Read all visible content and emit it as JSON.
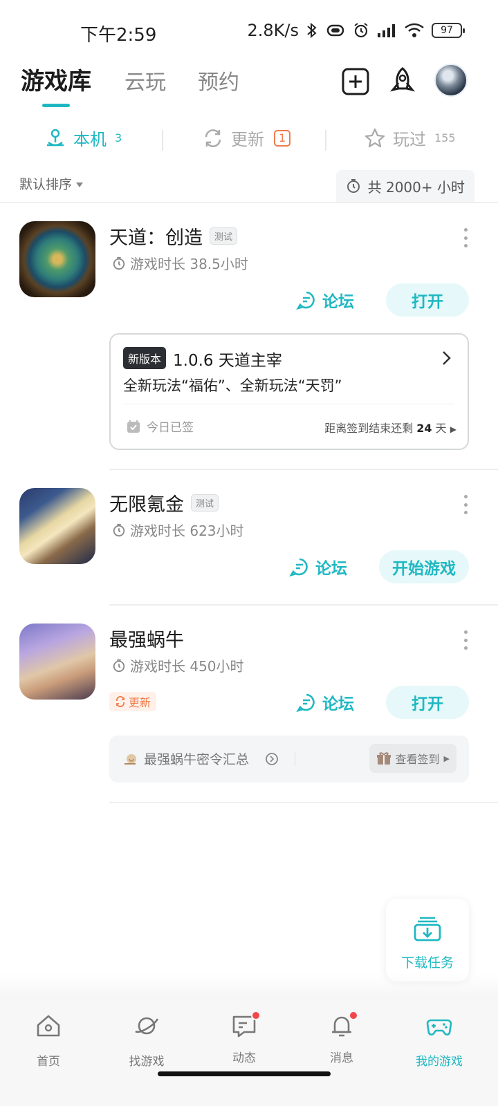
{
  "status_bar": {
    "time": "下午2:59",
    "speed": "2.8K/s",
    "battery": "97"
  },
  "top_nav": {
    "tabs": [
      {
        "label": "游戏库",
        "active": true
      },
      {
        "label": "云玩",
        "active": false
      },
      {
        "label": "预约",
        "active": false
      }
    ],
    "icons": [
      "add-icon",
      "rocket-icon",
      "avatar"
    ]
  },
  "sub_tabs": [
    {
      "label": "本机",
      "count": "3",
      "icon": "local-icon"
    },
    {
      "label": "更新",
      "badge": "1",
      "icon": "refresh-icon"
    },
    {
      "label": "玩过",
      "count": "155",
      "icon": "star-icon"
    }
  ],
  "sort": {
    "label": "默认排序",
    "total_time": "共 2000+ 小时"
  },
  "games": [
    {
      "title": "天道：创造",
      "tag": "测试",
      "play_time": "游戏时长 38.5小时",
      "forum": "论坛",
      "action": "打开",
      "version_card": {
        "badge": "新版本",
        "title": "1.0.6 天道主宰",
        "desc": "全新玩法“福佑”、全新玩法“天罚”",
        "signed": "今日已签",
        "sign_left_prefix": "距离签到结束还剩",
        "sign_left_days": "24",
        "sign_left_suffix": "天"
      }
    },
    {
      "title": "无限氪金",
      "tag": "测试",
      "play_time": "游戏时长 623小时",
      "forum": "论坛",
      "action": "开始游戏"
    },
    {
      "title": "最强蜗牛",
      "play_time": "游戏时长 450小时",
      "forum": "论坛",
      "action": "打开",
      "update_tag": "更新",
      "code_card": {
        "text": "最强蜗牛密令汇总",
        "checkin": "查看签到"
      }
    }
  ],
  "download_fab": {
    "label": "下载任务"
  },
  "bottom_nav": [
    {
      "label": "首页",
      "icon": "home-icon",
      "active": false,
      "dot": false
    },
    {
      "label": "找游戏",
      "icon": "planet-icon",
      "active": false,
      "dot": false
    },
    {
      "label": "动态",
      "icon": "chat-icon",
      "active": false,
      "dot": true
    },
    {
      "label": "消息",
      "icon": "bell-icon",
      "active": false,
      "dot": true
    },
    {
      "label": "我的游戏",
      "icon": "gamepad-icon",
      "active": true,
      "dot": false
    }
  ],
  "colors": {
    "accent": "#1fb8c2",
    "update": "#f07b4a",
    "dot": "#f2474a"
  }
}
